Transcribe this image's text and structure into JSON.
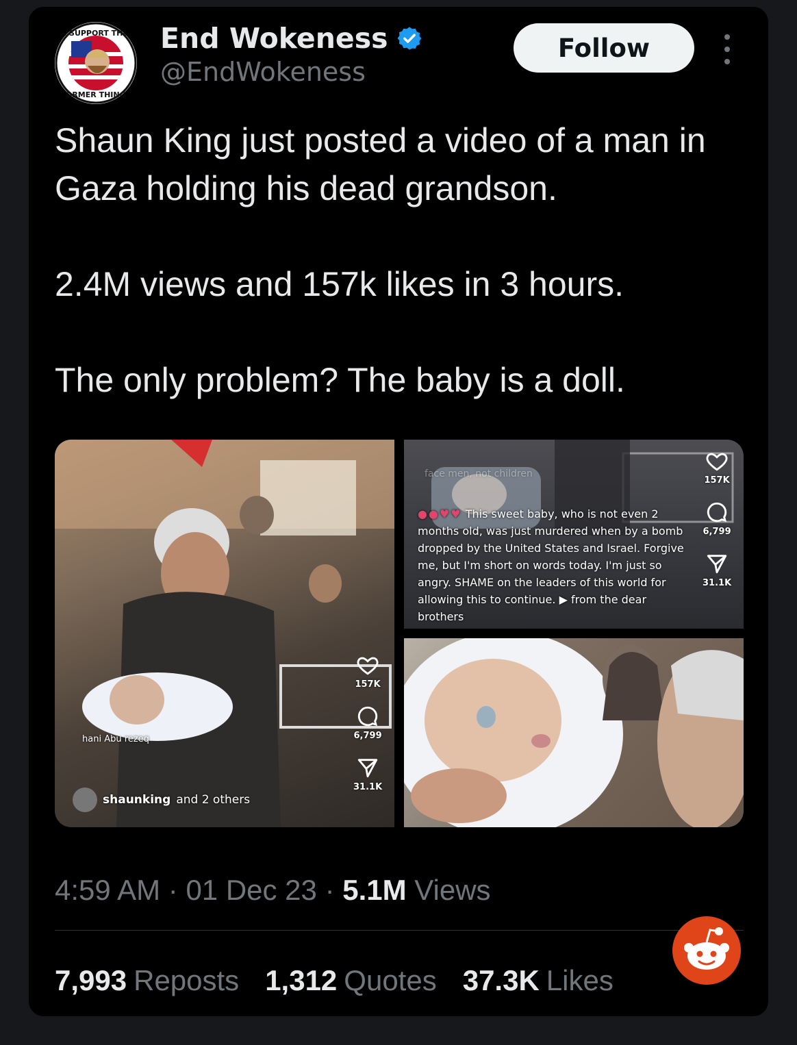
{
  "tweet": {
    "display_name": "End Wokeness",
    "handle": "@EndWokeness",
    "follow_label": "Follow",
    "avatar_icon": "support-the-former-things-badge-icon",
    "avatar_text_top": "I SUPPORT THE",
    "avatar_text_bottom": "FORMER THINGS",
    "verified_icon": "verified-badge-icon",
    "body": [
      "Shaun King just posted a video of a man in Gaza holding his dead grandson.",
      "2.4M views and 157k likes in 3 hours.",
      "The only problem? The baby is a doll."
    ],
    "time": "4:59 AM",
    "date": "01 Dec 23",
    "views_count": "5.1M",
    "views_label": "Views",
    "reposts_count": "7,993",
    "reposts_label": "Reposts",
    "quotes_count": "1,312",
    "quotes_label": "Quotes",
    "likes_count": "37.3K",
    "likes_label": "Likes"
  },
  "media": {
    "left": {
      "likes": "157K",
      "comments": "6,799",
      "shares": "31.1K",
      "watermark": "hani Abu rezeq",
      "collab": "shaunking",
      "collab_suffix": "and 2 others"
    },
    "top_right": {
      "likes": "157K",
      "comments": "6,799",
      "shares": "31.1K",
      "faded_text": "face men, not children",
      "caption": "This sweet baby, who is not even 2 months old, was just murdered when by a bomb dropped by the United States and Israel. Forgive me, but I'm short on words today. I'm just so angry. SHAME on the leaders of this world for allowing this to continue.",
      "caption_end": "from the dear brothers"
    }
  },
  "colors": {
    "background": "#000000",
    "text": "#e7e9ea",
    "secondary": "#71767b",
    "verified": "#1d9bf0",
    "reddit": "#e0451a"
  }
}
